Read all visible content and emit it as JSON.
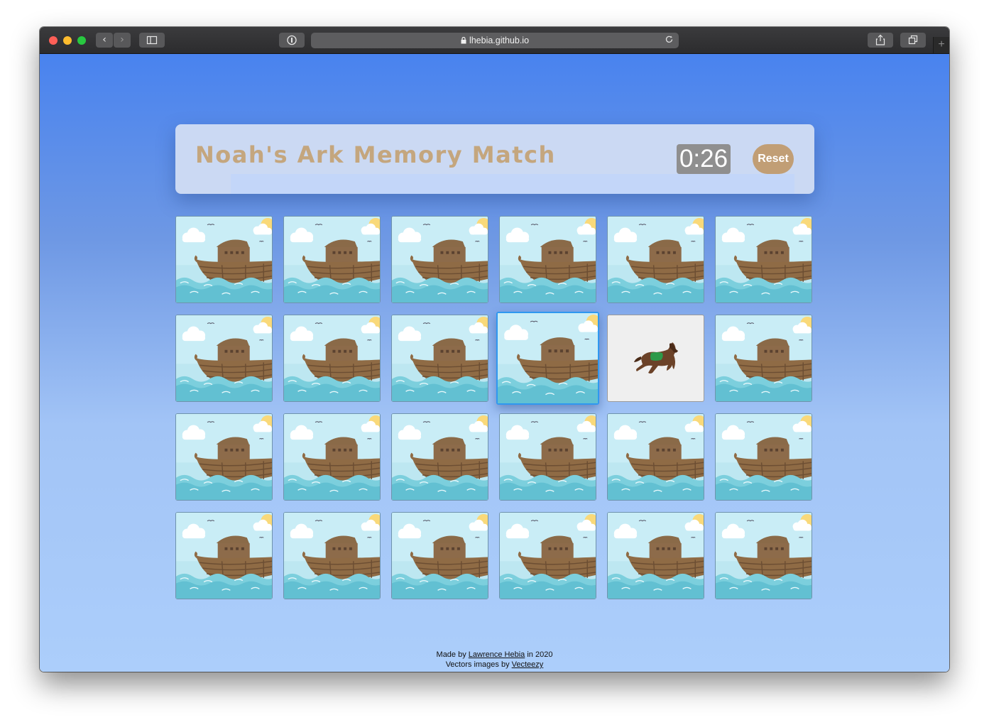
{
  "browser": {
    "url": "lhebia.github.io",
    "back_glyph": "‹",
    "forward_glyph": "›",
    "newtab_glyph": "+"
  },
  "game": {
    "title": "Noah's Ark Memory Match",
    "timer": "0:26",
    "reset_label": "Reset"
  },
  "board": {
    "rows": 4,
    "columns": 6,
    "card_back_icon": "ark-card-back",
    "face_up_card": {
      "row": 2,
      "column": 5,
      "icon": "horse"
    },
    "active_card": {
      "row": 2,
      "column": 4
    }
  },
  "footer": {
    "made_by_prefix": "Made by",
    "author": "Lawrence Hebia",
    "made_by_suffix": "in 2020",
    "vectors_prefix": "Vectors images by",
    "vectors_source": "Vecteezy"
  },
  "colors": {
    "title": "#c4a67e",
    "reset_button": "#c19e75",
    "timer_bg": "#8f8f8f",
    "background_top": "#4983ef",
    "background_bottom": "#accefb"
  }
}
